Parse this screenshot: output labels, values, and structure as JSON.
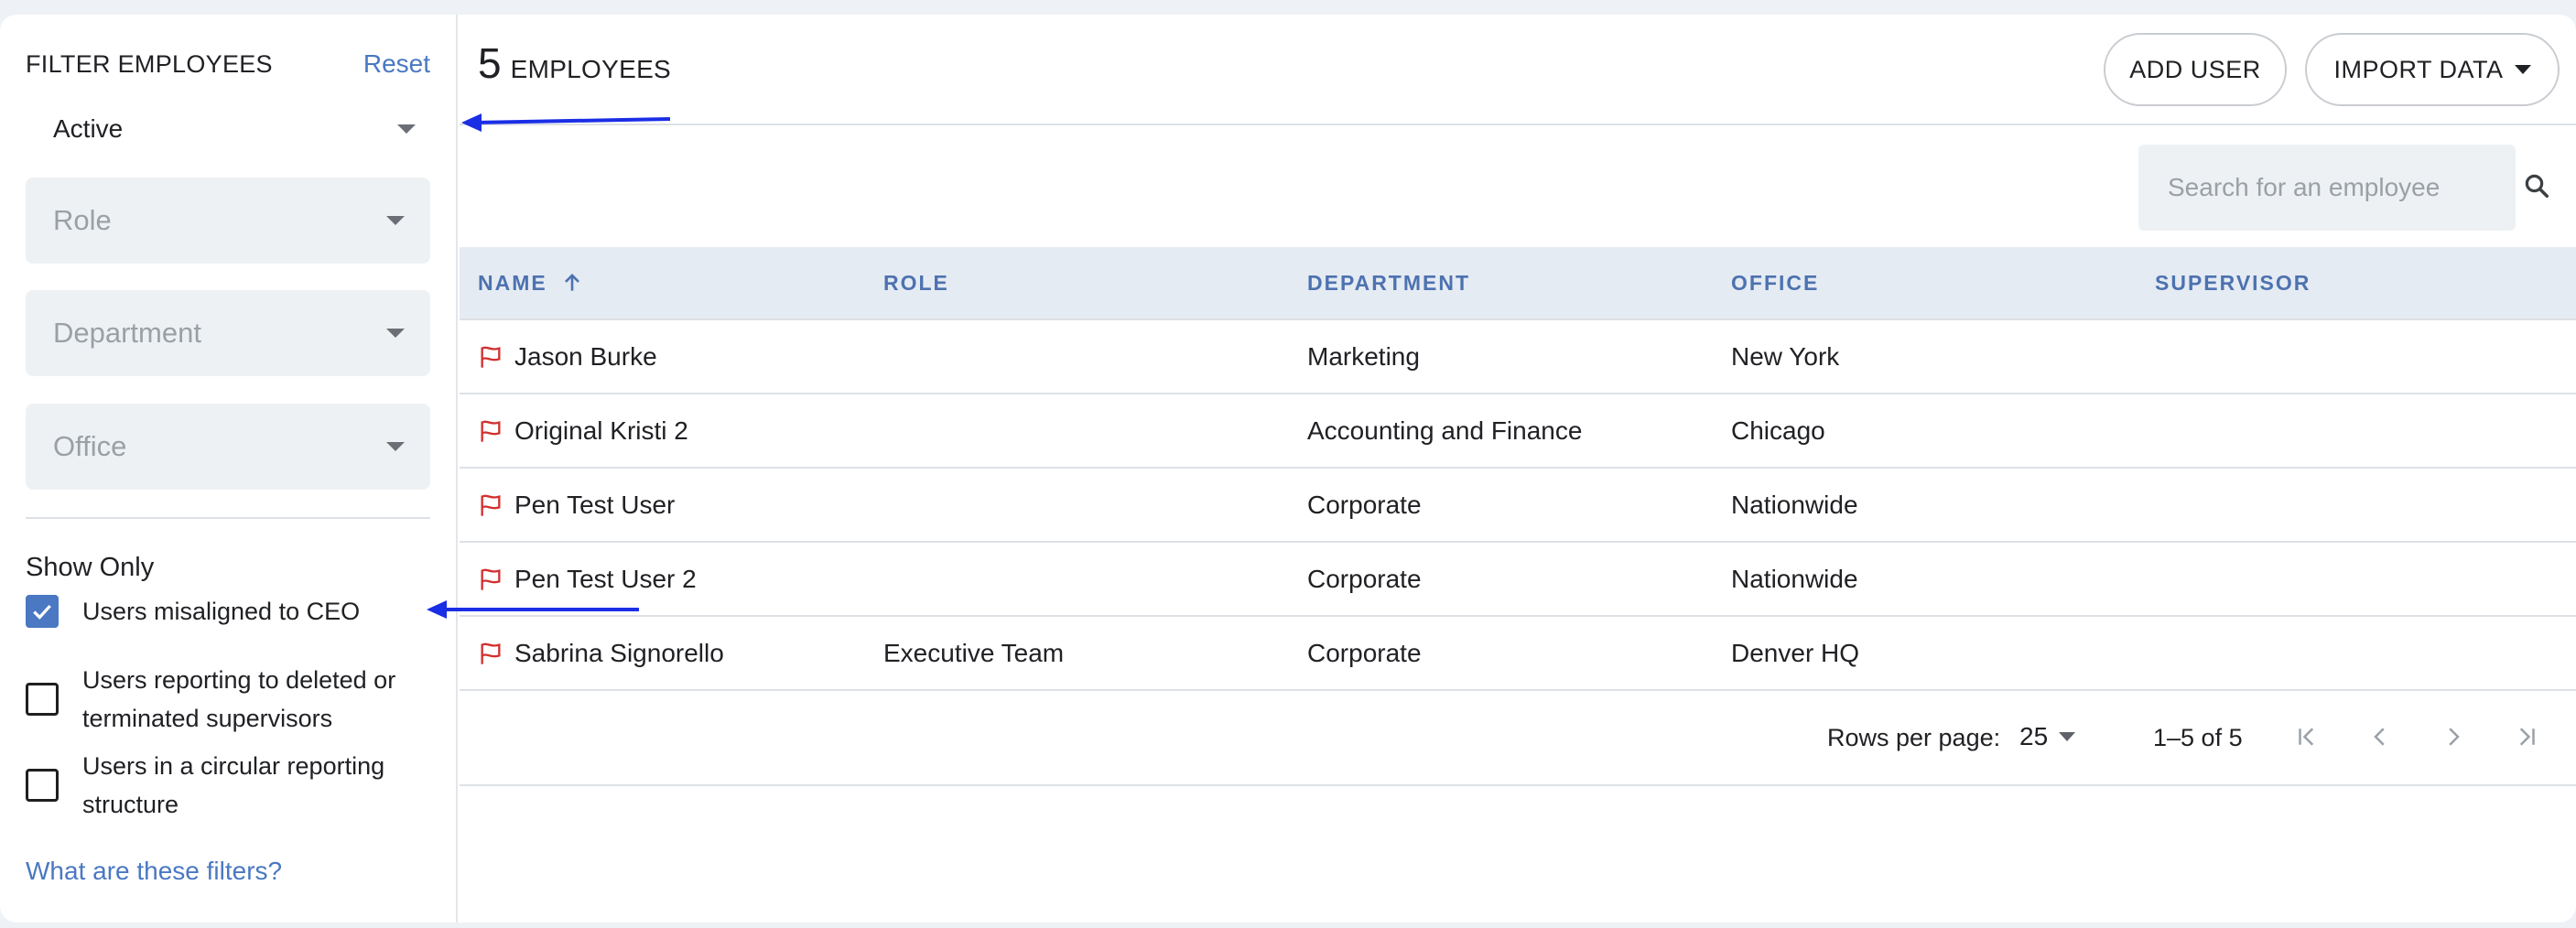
{
  "sidebar": {
    "title": "FILTER EMPLOYEES",
    "reset_label": "Reset",
    "status_value": "Active",
    "selects": [
      {
        "placeholder": "Role"
      },
      {
        "placeholder": "Department"
      },
      {
        "placeholder": "Office"
      }
    ],
    "show_only_label": "Show Only",
    "checkboxes": [
      {
        "label": "Users misaligned to CEO",
        "checked": true
      },
      {
        "label": "Users reporting to deleted or terminated supervisors",
        "checked": false
      },
      {
        "label": "Users in a circular reporting structure",
        "checked": false
      }
    ],
    "help_link": "What are these filters?"
  },
  "header": {
    "count": "5",
    "count_label": "EMPLOYEES",
    "add_user_label": "ADD USER",
    "import_label": "IMPORT DATA"
  },
  "search": {
    "placeholder": "Search for an employee",
    "value": ""
  },
  "table": {
    "columns": [
      "NAME",
      "ROLE",
      "DEPARTMENT",
      "OFFICE",
      "SUPERVISOR"
    ],
    "sort_icon": "arrow-up-icon",
    "row_icon": "flag-icon",
    "rows": [
      {
        "name": "Jason Burke",
        "role": "",
        "department": "Marketing",
        "office": "New York",
        "supervisor": ""
      },
      {
        "name": "Original Kristi 2",
        "role": "",
        "department": "Accounting and Finance",
        "office": "Chicago",
        "supervisor": ""
      },
      {
        "name": "Pen Test User",
        "role": "",
        "department": "Corporate",
        "office": "Nationwide",
        "supervisor": ""
      },
      {
        "name": "Pen Test User 2",
        "role": "",
        "department": "Corporate",
        "office": "Nationwide",
        "supervisor": ""
      },
      {
        "name": "Sabrina Signorello",
        "role": "Executive Team",
        "department": "Corporate",
        "office": "Denver HQ",
        "supervisor": ""
      }
    ]
  },
  "pagination": {
    "rows_per_page_label": "Rows per page:",
    "rows_per_page_value": "25",
    "range_text": "1–5 of 5"
  },
  "colors": {
    "accent": "#4a78c2",
    "header_text": "#4d72b0",
    "flag": "#d32f2f",
    "annotation_arrow": "#1a2ee6"
  }
}
